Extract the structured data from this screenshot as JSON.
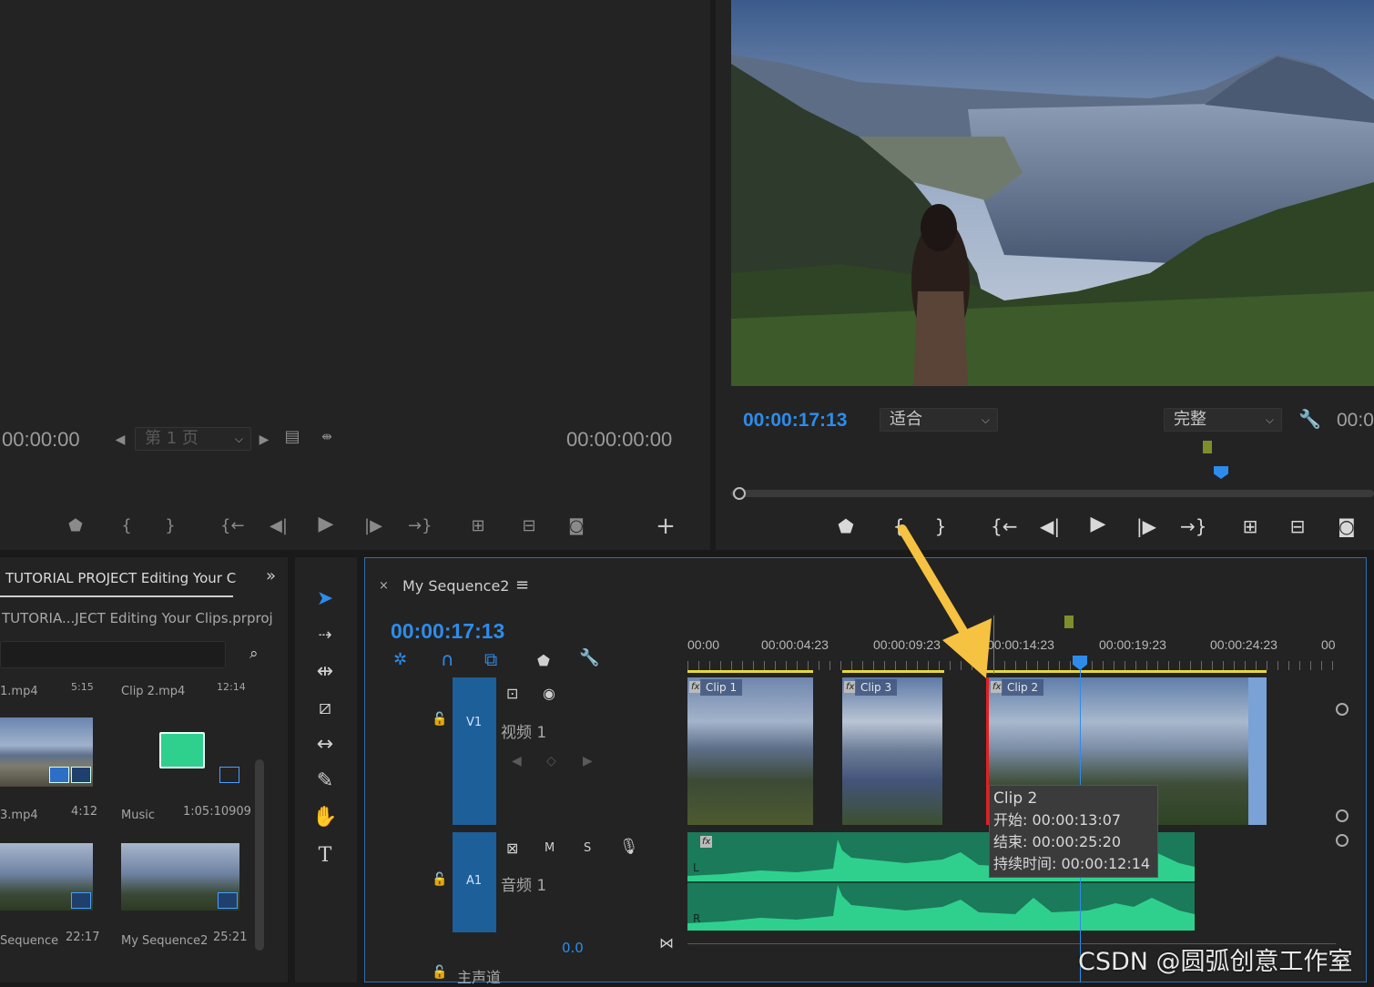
{
  "source_monitor": {
    "timecode_left": "00:00:00",
    "page_label": "第 1 页",
    "timecode_right": "00:00:00:00"
  },
  "program_monitor": {
    "timecode": "00:00:17:13",
    "fit_label": "适合",
    "quality_label": "完整",
    "timecode_right": "00:0"
  },
  "project": {
    "tab_title": "TUTORIAL PROJECT Editing Your C",
    "file_name": "TUTORIA...JECT Editing Your Clips.prproj",
    "items": [
      {
        "name": "1.mp4",
        "duration": "5:15"
      },
      {
        "name": "Clip 2.mp4",
        "duration": "12:14"
      },
      {
        "name": "3.mp4",
        "duration": "4:12"
      },
      {
        "name": "Music",
        "duration": "1:05:10909"
      },
      {
        "name": "Sequence",
        "duration": "22:17"
      },
      {
        "name": "My Sequence2",
        "duration": "25:21"
      }
    ]
  },
  "timeline": {
    "sequence_name": "My Sequence2",
    "timecode": "00:00:17:13",
    "ruler": [
      "00:00",
      "00:00:04:23",
      "00:00:09:23",
      "00:00:14:23",
      "00:00:19:23",
      "00:00:24:23",
      "00"
    ],
    "v1_label": "V1",
    "v1_name": "视频 1",
    "a1_label": "A1",
    "a1_name": "音频 1",
    "mix_label": "主声道",
    "mix_value": "0.0",
    "m_label": "M",
    "s_label": "S",
    "clips": [
      {
        "label": "Clip 1"
      },
      {
        "label": "Clip 3"
      },
      {
        "label": "Clip 2"
      }
    ],
    "fx_label": "fx",
    "audio_l": "L",
    "audio_r": "R",
    "tooltip": {
      "title": "Clip 2",
      "start": "开始: 00:00:13:07",
      "end": "结束: 00:00:25:20",
      "duration": "持续时间: 00:00:12:14"
    }
  },
  "watermark": "CSDN @圆弧创意工作室",
  "colors": {
    "timecode_blue": "#2d8ceb",
    "audio_green": "#2fd08e",
    "arrow_yellow": "#f5c242",
    "track_blue": "#1d5f99"
  }
}
